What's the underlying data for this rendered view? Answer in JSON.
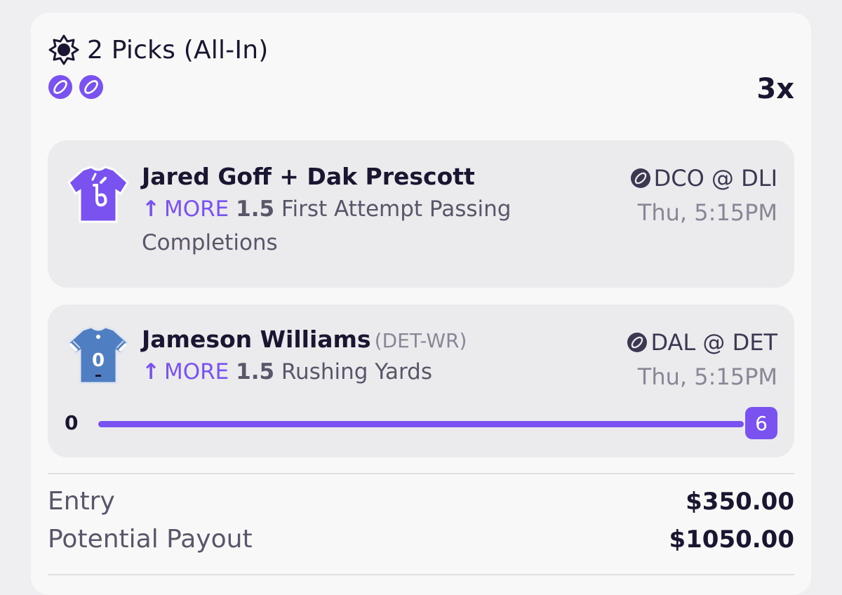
{
  "header": {
    "title": "2 Picks (All-In)",
    "multiplier": "3x",
    "sport_icons": [
      "football-icon",
      "football-icon"
    ]
  },
  "picks": [
    {
      "player": "Jared Goff + Dak Prescott",
      "team_pos": "",
      "direction": "MORE",
      "line": "1.5",
      "stat": "First Attempt Passing Completions",
      "matchup": "DCO @ DLI",
      "time": "Thu, 5:15PM",
      "jersey": "combo-jersey-icon"
    },
    {
      "player": "Jameson Williams",
      "team_pos": "(DET-WR)",
      "direction": "MORE",
      "line": "1.5",
      "stat": "Rushing Yards",
      "matchup": "DAL @ DET",
      "time": "Thu, 5:15PM",
      "jersey": "lions-jersey-icon",
      "progress": {
        "min": "0",
        "current": "6",
        "fraction": 1.0
      }
    }
  ],
  "summary": {
    "entry_label": "Entry",
    "entry_value": "$350.00",
    "payout_label": "Potential Payout",
    "payout_value": "$1050.00"
  },
  "colors": {
    "accent": "#7a52f0",
    "card": "#f8f8f9",
    "pick_bg": "#ebeaed",
    "text_dark": "#1a1530",
    "text_muted": "#8a8696"
  }
}
